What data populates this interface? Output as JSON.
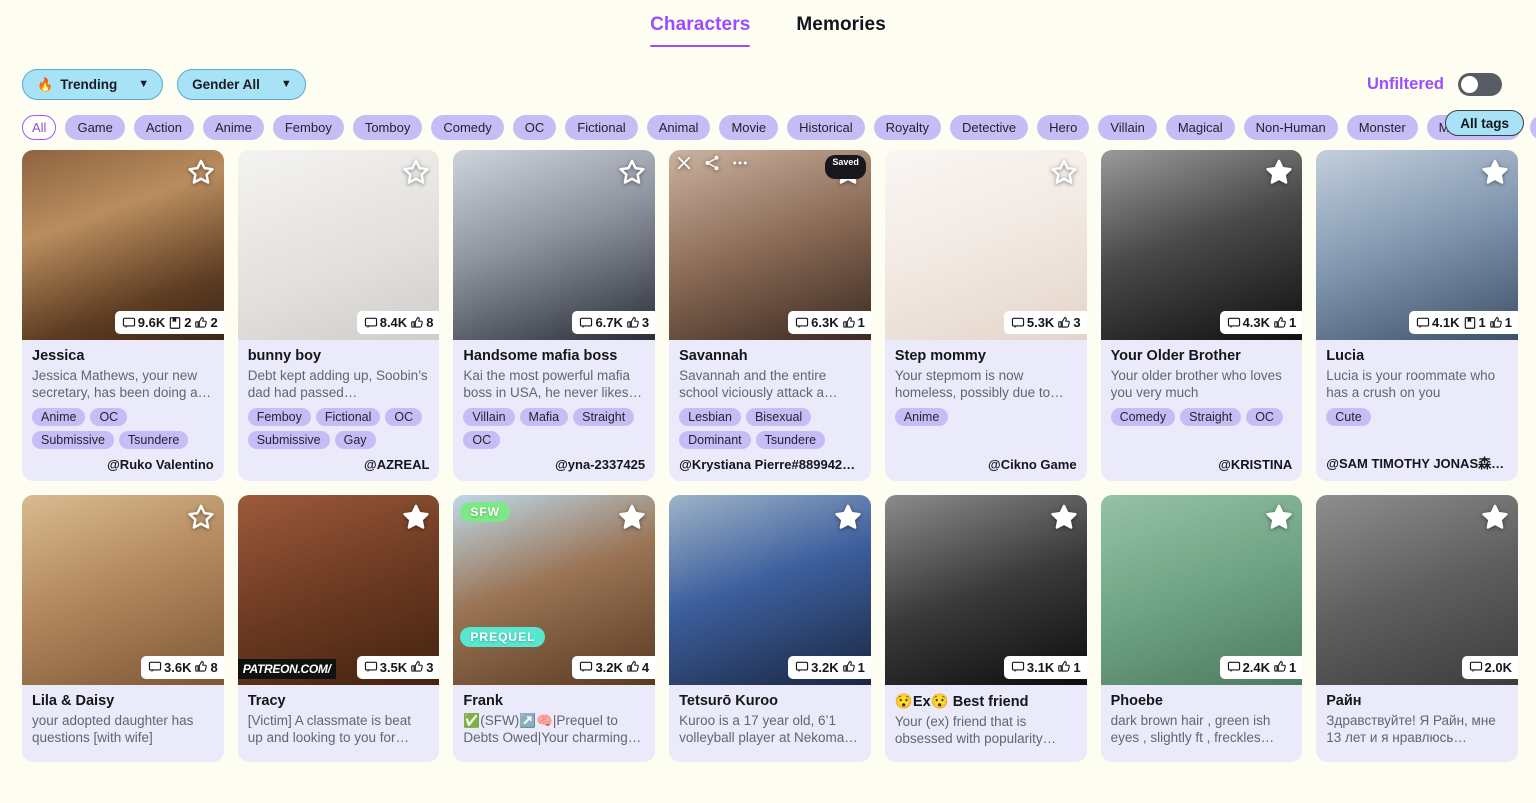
{
  "tabs": [
    {
      "label": "Characters",
      "active": true
    },
    {
      "label": "Memories",
      "active": false
    }
  ],
  "filters": {
    "sort_label": "Trending",
    "sort_icon": "flame-icon",
    "gender_label": "Gender All",
    "chevron": "⌄",
    "unfiltered_label": "Unfiltered",
    "unfiltered_on": false,
    "all_tags_label": "All tags"
  },
  "tag_filters": [
    {
      "label": "All",
      "selected": true
    },
    {
      "label": "Game",
      "selected": false
    },
    {
      "label": "Action",
      "selected": false
    },
    {
      "label": "Anime",
      "selected": false
    },
    {
      "label": "Femboy",
      "selected": false
    },
    {
      "label": "Tomboy",
      "selected": false
    },
    {
      "label": "Comedy",
      "selected": false
    },
    {
      "label": "OC",
      "selected": false
    },
    {
      "label": "Fictional",
      "selected": false
    },
    {
      "label": "Animal",
      "selected": false
    },
    {
      "label": "Movie",
      "selected": false
    },
    {
      "label": "Historical",
      "selected": false
    },
    {
      "label": "Royalty",
      "selected": false
    },
    {
      "label": "Detective",
      "selected": false
    },
    {
      "label": "Hero",
      "selected": false
    },
    {
      "label": "Villain",
      "selected": false
    },
    {
      "label": "Magical",
      "selected": false
    },
    {
      "label": "Non-Human",
      "selected": false
    },
    {
      "label": "Monster",
      "selected": false
    },
    {
      "label": "Monster Girl",
      "selected": false
    },
    {
      "label": "A",
      "selected": false
    }
  ],
  "cards": [
    {
      "name": "Jessica",
      "desc": "Jessica Mathews, your new secretary, has been doing a…",
      "tags": [
        "Anime",
        "OC",
        "Submissive",
        "Tsundere"
      ],
      "author": "@Ruko Valentino",
      "chats": "9.6K",
      "saves": "2",
      "likes": "2",
      "art": "a1"
    },
    {
      "name": "bunny boy",
      "desc": "Debt kept adding up, Soobin’s dad had passed…",
      "tags": [
        "Femboy",
        "Fictional",
        "OC",
        "Submissive",
        "Gay"
      ],
      "author": "@AZREAL",
      "chats": "8.4K",
      "likes": "8",
      "art": "a2"
    },
    {
      "name": "Handsome mafia boss",
      "desc": "Kai the most powerful mafia boss in USA, he never likes…",
      "tags": [
        "Villain",
        "Mafia",
        "Straight",
        "OC"
      ],
      "author": "@yna-2337425",
      "chats": "6.7K",
      "likes": "3",
      "art": "a3"
    },
    {
      "name": "Savannah",
      "desc": "Savannah and the entire school viciously attack a…",
      "tags": [
        "Lesbian",
        "Bisexual",
        "Dominant",
        "Tsundere"
      ],
      "author": "@Krystiana Pierre#889942…",
      "author_left": true,
      "chats": "6.3K",
      "likes": "1",
      "art": "a4",
      "hovered": true,
      "saved_label": "Saved",
      "star_filled": true
    },
    {
      "name": "Step mommy",
      "desc": "Your stepmom is now homeless, possibly due to…",
      "tags": [
        "Anime"
      ],
      "author": "@Cikno Game",
      "chats": "5.3K",
      "likes": "3",
      "art": "a5"
    },
    {
      "name": "Your Older Brother",
      "desc": "Your older brother who loves you very much",
      "tags": [
        "Comedy",
        "Straight",
        "OC"
      ],
      "author": "@KRISTINA",
      "chats": "4.3K",
      "likes": "1",
      "art": "a6",
      "star_filled": true
    },
    {
      "name": "Lucia",
      "desc": "Lucia is your roommate who has a crush on you",
      "tags": [
        "Cute"
      ],
      "author": "@SAM TIMOTHY JONAS森…",
      "author_left": true,
      "chats": "4.1K",
      "saves": "1",
      "likes": "1",
      "art": "a7",
      "star_filled": true
    },
    {
      "name": "Lila & Daisy",
      "desc": "your adopted daughter has questions [with wife]",
      "tags": [],
      "author": "",
      "chats": "3.6K",
      "likes": "8",
      "art": "a8"
    },
    {
      "name": "Tracy",
      "desc": "[Victim] A classmate is beat up and looking to you for…",
      "tags": [],
      "author": "",
      "chats": "3.5K",
      "likes": "3",
      "art": "a9",
      "star_filled": true,
      "watermark": "PATREON.COM/"
    },
    {
      "name": "Frank",
      "desc": "✅(SFW)↗️🧠|Prequel to Debts Owed|Your charming…",
      "tags": [],
      "author": "",
      "chats": "3.2K",
      "likes": "4",
      "art": "a10",
      "star_filled": true,
      "badges": [
        {
          "text": "SFW",
          "kind": "sfw"
        },
        {
          "text": "PREQUEL",
          "kind": "prequel"
        }
      ]
    },
    {
      "name": "Tetsurō Kuroo",
      "desc": "Kuroo is a 17 year old, 6’1 volleyball player at Nekoma…",
      "tags": [],
      "author": "",
      "chats": "3.2K",
      "likes": "1",
      "art": "a11",
      "star_filled": true
    },
    {
      "name": "😯Ex😯 Best friend",
      "desc": "Your (ex) friend that is obsessed with popularity…",
      "tags": [],
      "author": "",
      "chats": "3.1K",
      "likes": "1",
      "art": "a12",
      "star_filled": true
    },
    {
      "name": "Phoebe",
      "desc": "dark brown hair , green ish eyes , slightly ft , freckles…",
      "tags": [],
      "author": "",
      "chats": "2.4K",
      "likes": "1",
      "art": "a13",
      "star_filled": true
    },
    {
      "name": "Райн",
      "desc": "Здравствуйте! Я Райн, мне 13 лет и я нравлюсь…",
      "tags": [],
      "author": "",
      "chats": "2.0K",
      "art": "a14",
      "star_filled": true
    }
  ]
}
